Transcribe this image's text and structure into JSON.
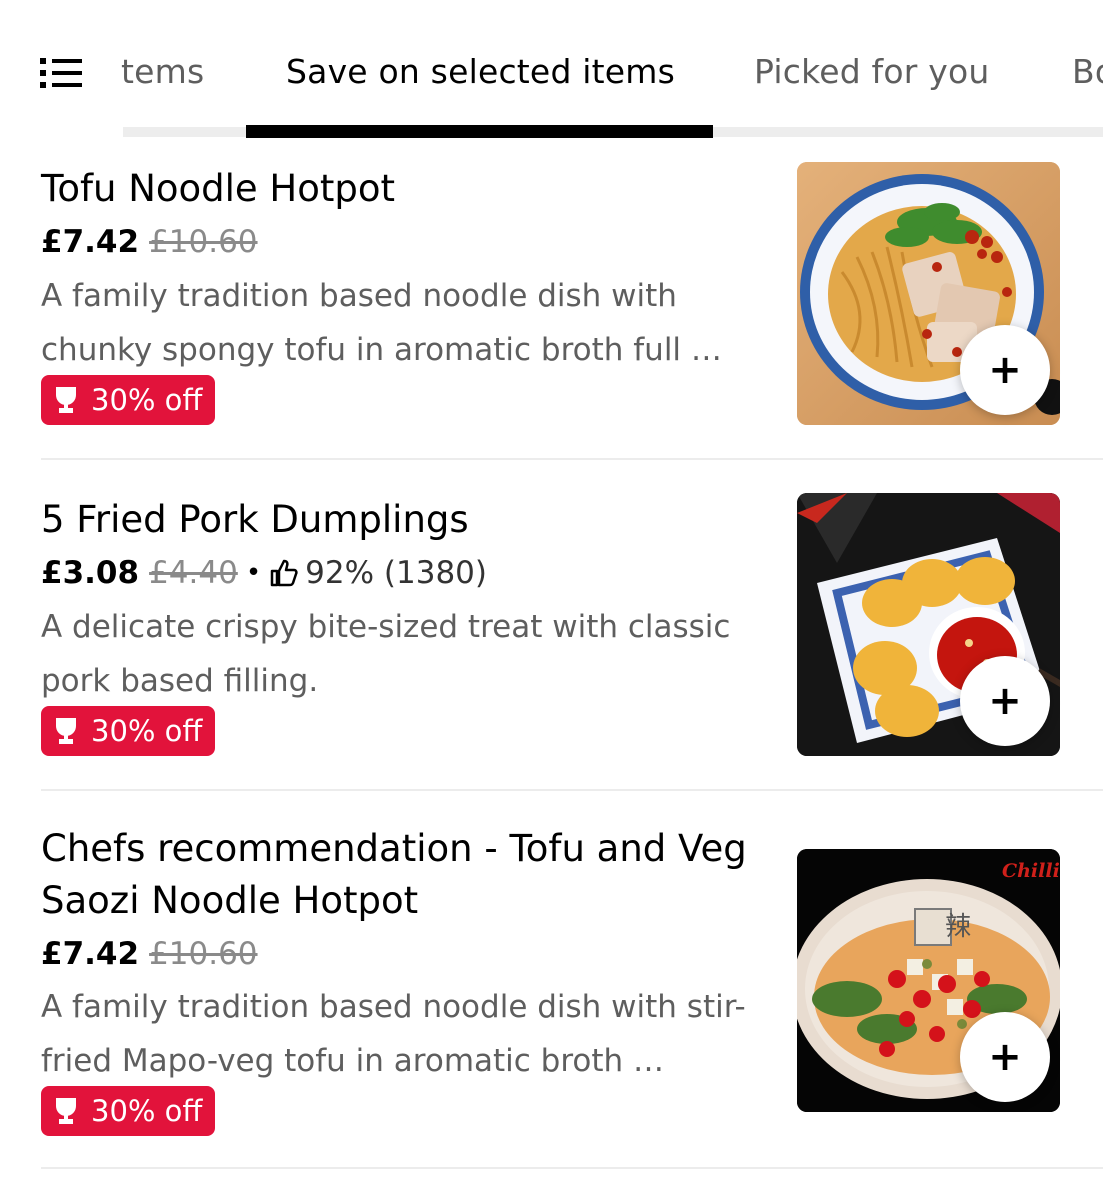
{
  "tabs": [
    {
      "label": "tems"
    },
    {
      "label": "Save on selected items",
      "active": true
    },
    {
      "label": "Picked for you"
    },
    {
      "label": "Bo"
    }
  ],
  "items": [
    {
      "title": "Tofu Noodle Hotpot",
      "price": "£7.42",
      "old_price": "£10.60",
      "description": "A family tradition based noodle dish with chunky spongy tofu in aromatic broth full …",
      "badge": "30% off",
      "image": "tofu-noodle-hotpot-photo",
      "add_label": "+"
    },
    {
      "title": "5 Fried Pork Dumplings",
      "price": "£3.08",
      "old_price": "£4.40",
      "separator": "•",
      "rating": "92% (1380)",
      "description": "A delicate crispy bite-sized treat with classic pork based filling.",
      "badge": "30% off",
      "image": "fried-pork-dumplings-photo",
      "add_label": "+"
    },
    {
      "title": "Chefs recommendation - Tofu and Veg Saozi Noodle Hotpot",
      "price": "£7.42",
      "old_price": "£10.60",
      "description": "A family tradition based noodle dish with stir-fried Mapo-veg tofu in aromatic broth …",
      "badge": "30% off",
      "image": "saozi-noodle-hotpot-photo",
      "image_text": "Chilli I",
      "add_label": "+"
    }
  ],
  "colors": {
    "badge": "#e2133b",
    "text": "#000000",
    "muted": "#5e5e5e",
    "strike": "#8a8a8a"
  }
}
